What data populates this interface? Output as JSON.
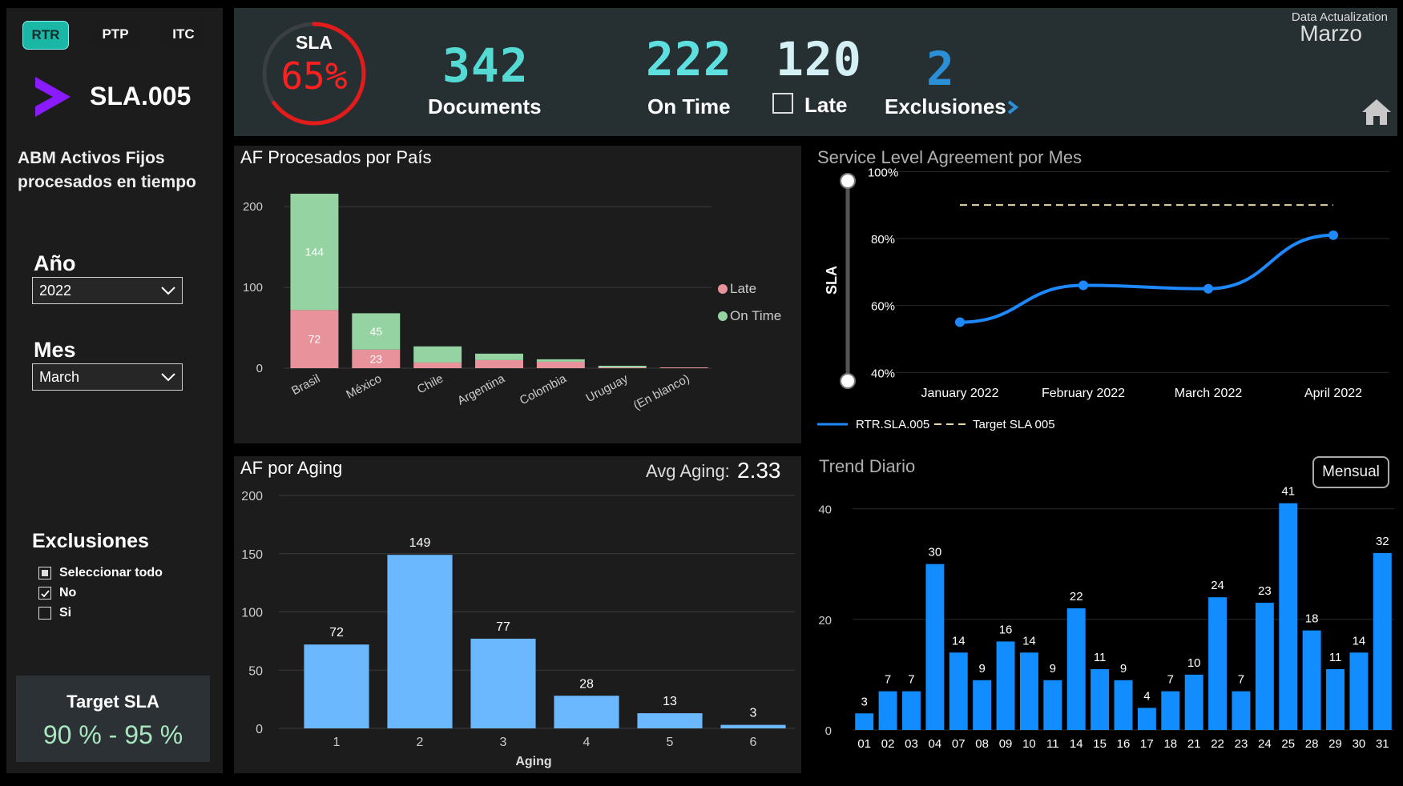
{
  "sidebar": {
    "tabs": [
      {
        "label": "RTR",
        "active": true
      },
      {
        "label": "PTP",
        "active": false
      },
      {
        "label": "ITC",
        "active": false
      }
    ],
    "report_code": "SLA.005",
    "description_line1": "ABM Activos Fijos",
    "description_line2": "procesados en tiempo",
    "year_label": "Año",
    "year_value": "2022",
    "month_label": "Mes",
    "month_value": "March",
    "exclusions_label": "Exclusiones",
    "exclusion_options": [
      {
        "label": "Seleccionar todo",
        "state": "partial"
      },
      {
        "label": "No",
        "state": "checked"
      },
      {
        "label": "Si",
        "state": "unchecked"
      }
    ],
    "target_label": "Target SLA",
    "target_value": "90 % - 95 %"
  },
  "kpi": {
    "sla_label": "SLA",
    "sla_value": "65%",
    "sla_fraction": 0.65,
    "documents_value": "342",
    "documents_label": "Documents",
    "ontime_value": "222",
    "ontime_label": "On Time",
    "late_value": "120",
    "late_label": "Late",
    "exclusions_value": "2",
    "exclusions_label": "Exclusiones",
    "data_actualization_label": "Data Actualization",
    "data_actualization_value": "Marzo"
  },
  "aging_header": {
    "avg_label": "Avg Aging:",
    "avg_value": "2.33"
  },
  "trend_header": {
    "toggle_label": "Mensual"
  },
  "colors": {
    "late": "#e8939b",
    "ontime": "#96d3a2",
    "aging_bar": "#6cb8ff",
    "trend_bar": "#118dff",
    "sla_line": "#1e88ff",
    "target_line": "#e8d7a0",
    "accent": "#7f1eff"
  },
  "chart_data": [
    {
      "type": "bar",
      "title": "AF Procesados por País",
      "categories": [
        "Brasil",
        "México",
        "Chile",
        "Argentina",
        "Colombia",
        "Uruguay",
        "(En blanco)"
      ],
      "series": [
        {
          "name": "Late",
          "values": [
            72,
            23,
            7,
            10,
            8,
            1,
            1
          ]
        },
        {
          "name": "On Time",
          "values": [
            144,
            45,
            20,
            8,
            3,
            2,
            0
          ]
        }
      ],
      "data_labels": {
        "Late": [
          72,
          23,
          null,
          null,
          null,
          null,
          null
        ],
        "On Time": [
          144,
          45,
          null,
          null,
          null,
          null,
          null
        ]
      },
      "y_ticks": [
        0,
        100,
        200
      ],
      "ylim": [
        0,
        220
      ],
      "legend": "right"
    },
    {
      "type": "line",
      "title": "Service Level Agreement por Mes",
      "categories": [
        "January 2022",
        "February 2022",
        "March 2022",
        "April 2022"
      ],
      "series": [
        {
          "name": "RTR.SLA.005",
          "values": [
            0.55,
            0.66,
            0.65,
            0.81
          ]
        },
        {
          "name": "Target SLA 005",
          "values": [
            0.9,
            0.9,
            0.9,
            0.9
          ]
        }
      ],
      "ylabel": "SLA",
      "y_ticks": [
        "40%",
        "60%",
        "80%",
        "100%"
      ],
      "ylim": [
        0.36,
        1.02
      ],
      "legend": "bottom-left"
    },
    {
      "type": "bar",
      "title": "AF por Aging",
      "categories": [
        "1",
        "2",
        "3",
        "4",
        "5",
        "6"
      ],
      "values": [
        72,
        149,
        77,
        28,
        13,
        3
      ],
      "xlabel": "Aging",
      "y_ticks": [
        0,
        50,
        100,
        150,
        200
      ],
      "ylim": [
        0,
        200
      ]
    },
    {
      "type": "bar",
      "title": "Trend Diario",
      "categories": [
        "01",
        "02",
        "03",
        "04",
        "07",
        "08",
        "09",
        "10",
        "11",
        "14",
        "15",
        "16",
        "17",
        "18",
        "21",
        "22",
        "23",
        "24",
        "25",
        "28",
        "29",
        "30",
        "31"
      ],
      "values": [
        3,
        7,
        7,
        30,
        14,
        9,
        16,
        14,
        9,
        22,
        11,
        9,
        4,
        7,
        10,
        24,
        7,
        23,
        41,
        18,
        11,
        14,
        32
      ],
      "y_ticks": [
        0,
        20,
        40
      ],
      "ylim": [
        0,
        44
      ]
    }
  ]
}
